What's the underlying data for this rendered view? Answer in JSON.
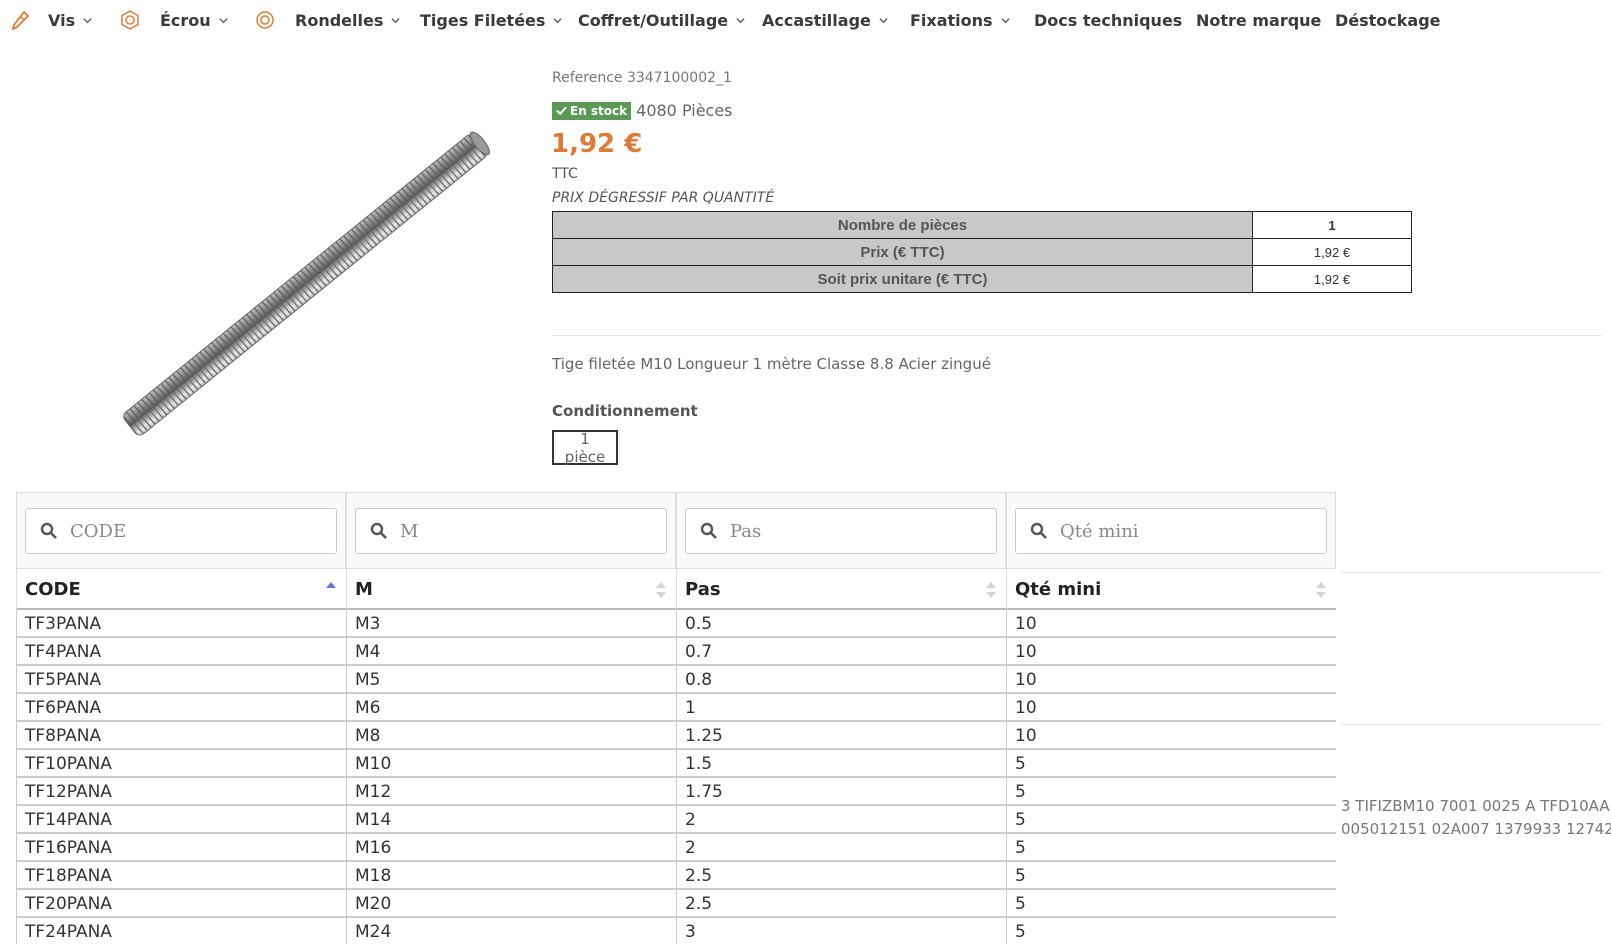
{
  "colors": {
    "accent": "#e07a36",
    "stock_green": "#5a9a56",
    "table_header_bg": "#c8c8c8",
    "sort_active": "#6b73d6"
  },
  "nav": {
    "items": [
      {
        "label": "Vis",
        "icon": "screw-icon"
      },
      {
        "label": "Écrou",
        "icon": "nut-icon"
      },
      {
        "label": "Rondelles",
        "icon": "washer-icon"
      },
      {
        "label": "Tiges Filetées"
      },
      {
        "label": "Coffret/Outillage"
      },
      {
        "label": "Accastillage"
      },
      {
        "label": "Fixations"
      },
      {
        "label": "Docs techniques"
      },
      {
        "label": "Notre marque"
      },
      {
        "label": "Déstockage"
      }
    ]
  },
  "product": {
    "reference": "Reference 3347100002_1",
    "stock_badge": "En stock",
    "stock_count": "4080 Pièces",
    "price": "1,92 €",
    "tax_label": "TTC",
    "degressif_label": "PRIX DÉGRESSIF PAR QUANTITÉ",
    "qty_table": [
      {
        "label": "Nombre de pièces",
        "value": "1"
      },
      {
        "label": "Prix (€ TTC)",
        "value": "1,92 €"
      },
      {
        "label": "Soit prix unitare (€ TTC)",
        "value": "1,92 €"
      }
    ],
    "description": "Tige filetée M10 Longueur 1 mètre Classe 8.8 Acier zingué",
    "conditionnement_label": "Conditionnement",
    "conditionnement_option": "1 pièce",
    "side_text_1": "3 TIFIZBM10 7001 0025 A TFD10AA",
    "side_text_2": "005012151 02A007 1379933 12742"
  },
  "table": {
    "filters": [
      {
        "placeholder": "CODE"
      },
      {
        "placeholder": "M"
      },
      {
        "placeholder": "Pas"
      },
      {
        "placeholder": "Qté mini"
      }
    ],
    "columns": [
      "CODE",
      "M",
      "Pas",
      "Qté mini"
    ],
    "sorted_column": "CODE",
    "rows": [
      [
        "TF3PANA",
        "M3",
        "0.5",
        "10"
      ],
      [
        "TF4PANA",
        "M4",
        "0.7",
        "10"
      ],
      [
        "TF5PANA",
        "M5",
        "0.8",
        "10"
      ],
      [
        "TF6PANA",
        "M6",
        "1",
        "10"
      ],
      [
        "TF8PANA",
        "M8",
        "1.25",
        "10"
      ],
      [
        "TF10PANA",
        "M10",
        "1.5",
        "5"
      ],
      [
        "TF12PANA",
        "M12",
        "1.75",
        "5"
      ],
      [
        "TF14PANA",
        "M14",
        "2",
        "5"
      ],
      [
        "TF16PANA",
        "M16",
        "2",
        "5"
      ],
      [
        "TF18PANA",
        "M18",
        "2.5",
        "5"
      ],
      [
        "TF20PANA",
        "M20",
        "2.5",
        "5"
      ],
      [
        "TF24PANA",
        "M24",
        "3",
        "5"
      ]
    ]
  }
}
